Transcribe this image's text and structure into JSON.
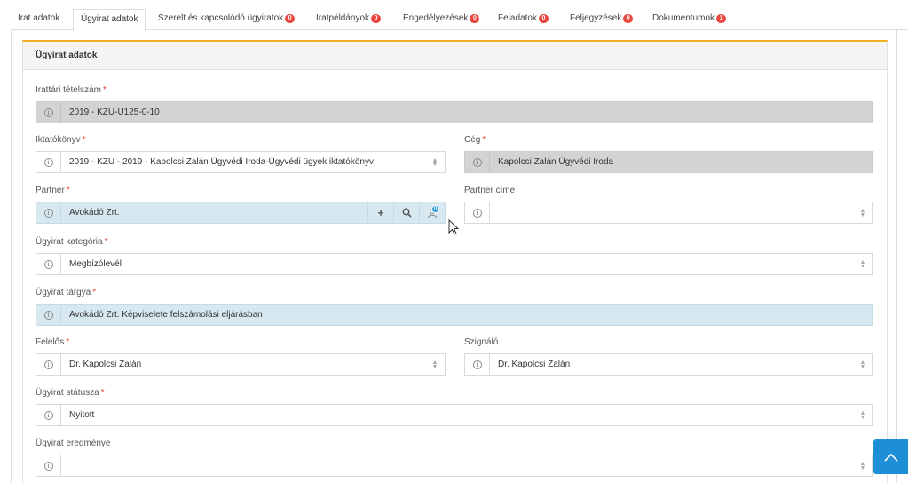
{
  "tabs": [
    {
      "label": "Irat adatok",
      "badge": ""
    },
    {
      "label": "Ügyirat adatok",
      "badge": ""
    },
    {
      "label": "Szerelt és kapcsolódó ügyiratok",
      "badge": "0"
    },
    {
      "label": "Iratpéldányok",
      "badge": "0"
    },
    {
      "label": "Engedélyezések",
      "badge": "0"
    },
    {
      "label": "Feladatok",
      "badge": "0"
    },
    {
      "label": "Feljegyzések",
      "badge": "0"
    },
    {
      "label": "Dokumentumok",
      "badge": "1"
    }
  ],
  "panel": {
    "title": "Ügyirat adatok"
  },
  "form": {
    "irattari_tetelszam": {
      "label": "Irattári tételszám",
      "value": "2019 - KZU-U125-0-10"
    },
    "iktatokonyv": {
      "label": "Iktatókönyv",
      "value": "2019 - KZU - 2019 - Kapolcsi Zalán Ügyvédi Iroda-Ügyvédi ügyek iktatókönyv"
    },
    "ceg": {
      "label": "Cég",
      "value": "Kapolcsi Zalán Ügyvédi Iroda"
    },
    "partner": {
      "label": "Partner",
      "value": "Avokádó Zrt.",
      "notif_badge": "0"
    },
    "partner_cime": {
      "label": "Partner címe",
      "value": ""
    },
    "ugyirat_kategoria": {
      "label": "Ügyirat kategória",
      "value": "Megbízólevél"
    },
    "ugyirat_targya": {
      "label": "Ügyirat tárgya",
      "value": "Avokádó Zrt. Képviselete felszámolási eljárásban"
    },
    "felelos": {
      "label": "Felelős",
      "value": "Dr. Kapolcsi Zalán"
    },
    "szignalo": {
      "label": "Szignáló",
      "value": "Dr. Kapolcsi Zalán"
    },
    "ugyirat_statusza": {
      "label": "Ügyirat státusza",
      "value": "Nyitott"
    },
    "ugyirat_eredmenye": {
      "label": "Ügyirat eredménye",
      "value": ""
    }
  },
  "required_mark": "*",
  "colors": {
    "accent": "#f0ad1e",
    "badge": "#e8463e",
    "readonly": "#d1d3d4",
    "highlight": "#d7e8f0",
    "scroll_button": "#1c8fd7"
  }
}
